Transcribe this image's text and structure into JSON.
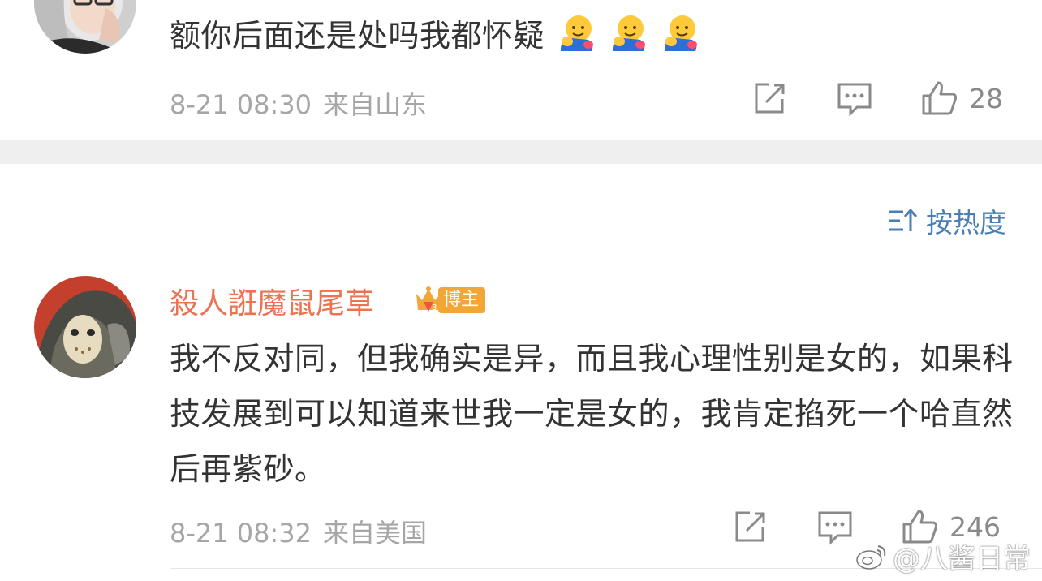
{
  "comments": [
    {
      "text": "额你后面还是处吗我都怀疑",
      "emojis": [
        "hug-emoji",
        "hug-emoji",
        "hug-emoji"
      ],
      "date": "8-21 08:30",
      "location": "来自山东",
      "likes": "28"
    },
    {
      "username": "殺人誑魔鼠尾草",
      "badge": "博主",
      "text": "我不反对同，但我确实是异，而且我心理性别是女的，如果科技发展到可以知道来世我一定是女的，我肯定掐死一个哈直然后再紫砂。",
      "date": "8-21 08:32",
      "location": "来自美国",
      "likes": "246"
    }
  ],
  "sort": {
    "label": "按热度",
    "icon": "sort-icon"
  },
  "watermark": {
    "text": "@八酱日常",
    "icon": "weibo-logo"
  },
  "icons": {
    "repost": "repost-icon",
    "comment": "comment-icon",
    "like": "thumbs-up-icon"
  },
  "colors": {
    "username": "#eb7350",
    "sort": "#4a7fb5",
    "badge": "#f3a638",
    "meta": "#a6a6a6"
  }
}
